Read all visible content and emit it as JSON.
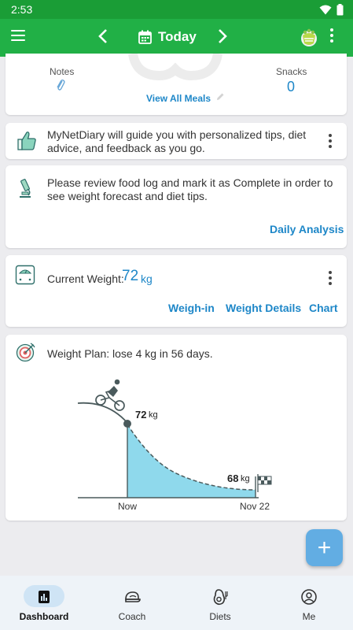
{
  "status_bar": {
    "time": "2:53"
  },
  "header": {
    "date_label": "Today"
  },
  "meals_card": {
    "notes_label": "Notes",
    "snacks_label": "Snacks",
    "snacks_count": "0",
    "view_all_label": "View All Meals"
  },
  "tip_card": {
    "text": "MyNetDiary will guide you with personalized tips, diet advice, and feedback as you go."
  },
  "analysis_card": {
    "text": "Please review food log and mark it as Complete in order to see weight forecast and diet tips.",
    "link_label": "Daily Analysis"
  },
  "weight_card": {
    "label": "Current Weight:",
    "value": "72",
    "unit": "kg",
    "actions": [
      "Weigh-in",
      "Weight Details",
      "Chart"
    ]
  },
  "plan_card": {
    "title": "Weight Plan: lose 4 kg in 56 days.",
    "start_value": "72",
    "start_unit": "kg",
    "end_value": "68",
    "end_unit": "kg",
    "start_label": "Now",
    "end_label": "Nov 22"
  },
  "fab": {
    "symbol": "+"
  },
  "bottom_nav": {
    "items": [
      {
        "label": "Dashboard",
        "active": true
      },
      {
        "label": "Coach"
      },
      {
        "label": "Diets"
      },
      {
        "label": "Me"
      }
    ]
  },
  "colors": {
    "primary_green": "#21b046",
    "status_green": "#1a9d36",
    "link_blue": "#1e87c8",
    "fab_blue": "#62ade3",
    "plan_fill": "#8fd9ec"
  }
}
